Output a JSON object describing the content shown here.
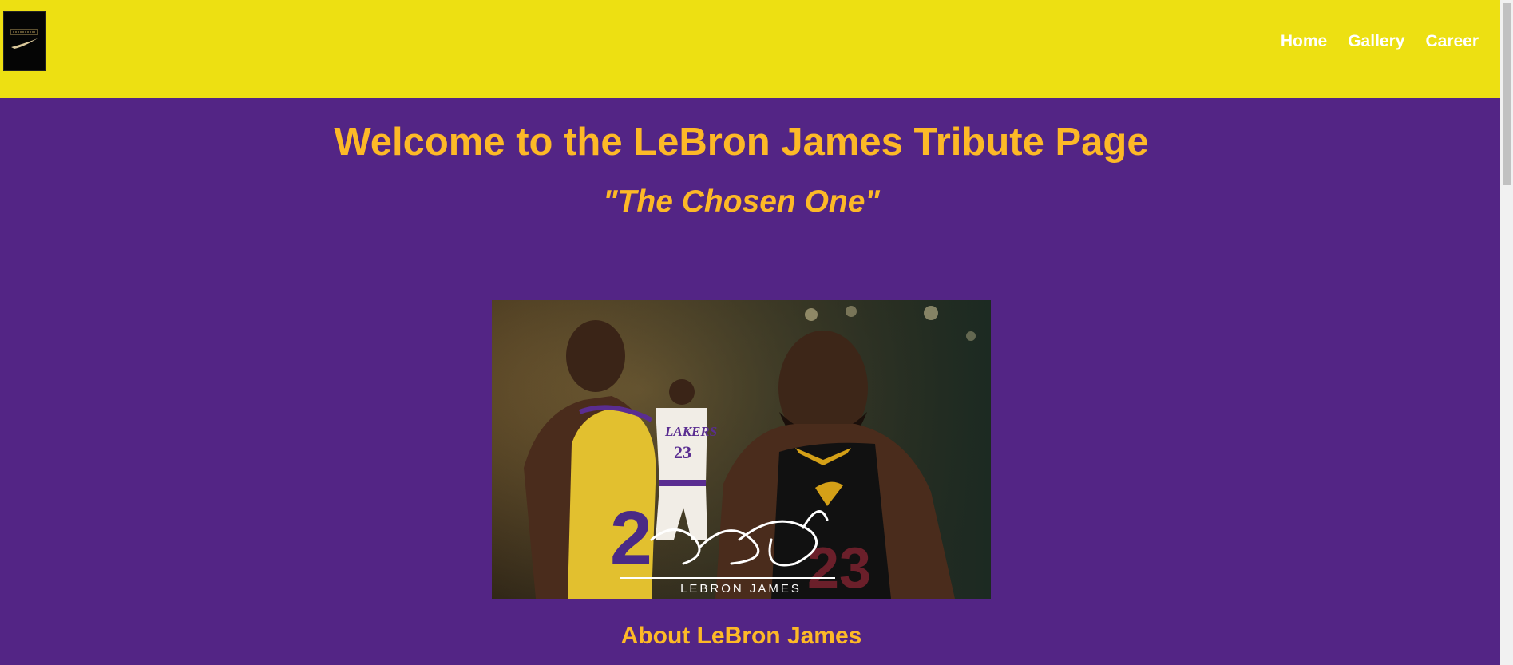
{
  "header": {
    "logo_icon": "lebron-nike-logo",
    "nav": {
      "home": "Home",
      "gallery": "Gallery",
      "career": "Career"
    }
  },
  "main": {
    "title": "Welcome to the LeBron James Tribute Page",
    "subtitle": "\"The Chosen One\"",
    "hero_caption": "LEBRON JAMES",
    "about_heading": "About LeBron James"
  },
  "colors": {
    "header_bg": "#ede012",
    "page_bg": "#532585",
    "heading_gold": "#fdb927",
    "nav_text": "#ffffff"
  }
}
